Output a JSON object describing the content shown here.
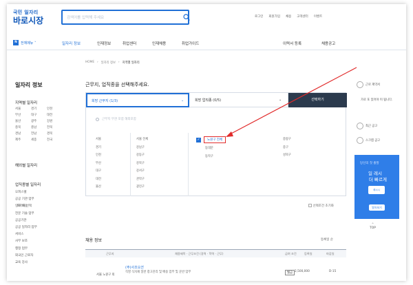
{
  "header": {
    "logo_top": "국민 일자리",
    "logo_main": "바로시장",
    "search_placeholder": "검색어를 입력해 주세요",
    "top_links": [
      "로그인",
      "회원가입",
      "채용",
      "고객센터",
      "이벤트"
    ]
  },
  "gnb": {
    "badge": "N",
    "all_label": "전체메뉴 ˅",
    "items": [
      "일자리 정보",
      "인재정보",
      "취업센터",
      "인재채용",
      "취업가이드"
    ],
    "right_items": [
      "이력서 등록",
      "채용공고"
    ]
  },
  "breadcrumb": [
    "HOME",
    "일자리 정보",
    "지역별 일자리"
  ],
  "sidebar": {
    "title": "일자리 정보",
    "region_heading": "지역별 일자리",
    "regions": [
      "서울",
      "경기",
      "인천",
      "부산",
      "대구",
      "대전",
      "울산",
      "광주",
      "강원",
      "충북",
      "충남",
      "전북",
      "경남",
      "전남",
      "경북",
      "제주",
      "세종",
      "전국"
    ],
    "overseas": "해외별 일자리",
    "job_heading": "업직종별 일자리",
    "job_items": [
      "오피스텔",
      "공공 기관 업무",
      "인재 채용",
      "전문 기술 업무",
      "공공기관",
      "공공 일자리 업무",
      "서비스",
      "사무 보조",
      "행정 업무",
      "외국인 근로자",
      "교육 강사"
    ]
  },
  "main": {
    "title": "근무지, 업직종을 선택해주세요.",
    "tab1": "희망 근무지 (1/3)",
    "tab2": "희망 업직종 (0/5)",
    "tab_button": "선택하기",
    "checkbox_label": "근무지 무관 포함 해외포함",
    "col1": [
      "서울",
      "경기",
      "인천",
      "부산",
      "대구",
      "대전",
      "울산"
    ],
    "col2": [
      "서울 전체",
      "강남구",
      "강동구",
      "강북구",
      "강서구",
      "관악구",
      "광진구"
    ],
    "selected_label": "노원구 전체",
    "col3": [
      "동대문",
      "동작구"
    ],
    "col4": [
      "중랑구",
      "중구",
      "성북구"
    ],
    "reset_label": "초기화 선택",
    "reset_right": "선택조건 초기화"
  },
  "results": {
    "title": "채용 정보",
    "sort": "등록일 순",
    "headers": [
      "근무지",
      "채용제목 · 근무조건 (경력 · 학력 · 근무)",
      "급여 조건",
      "등록일",
      "마감일"
    ],
    "row": {
      "location": "서울 노원구 외",
      "company": "(주)사조오션",
      "text": "직영 식자재 일반 창고관리 및 배송 업무 및 운반 업무",
      "badge": "월급",
      "date": "2,500,000",
      "dday": "D-15"
    }
  },
  "right_rail": {
    "items": [
      "근로 계약서",
      "가로 포 있어야 이 됩니다.",
      "최근 공고",
      "스크랩 공고"
    ],
    "ad": {
      "top": "당신의 첫 출발",
      "title1": "일 레시",
      "title2": "더 빠르게",
      "logo": "레시시",
      "button": "알아보기"
    },
    "top_button": "TOP"
  }
}
